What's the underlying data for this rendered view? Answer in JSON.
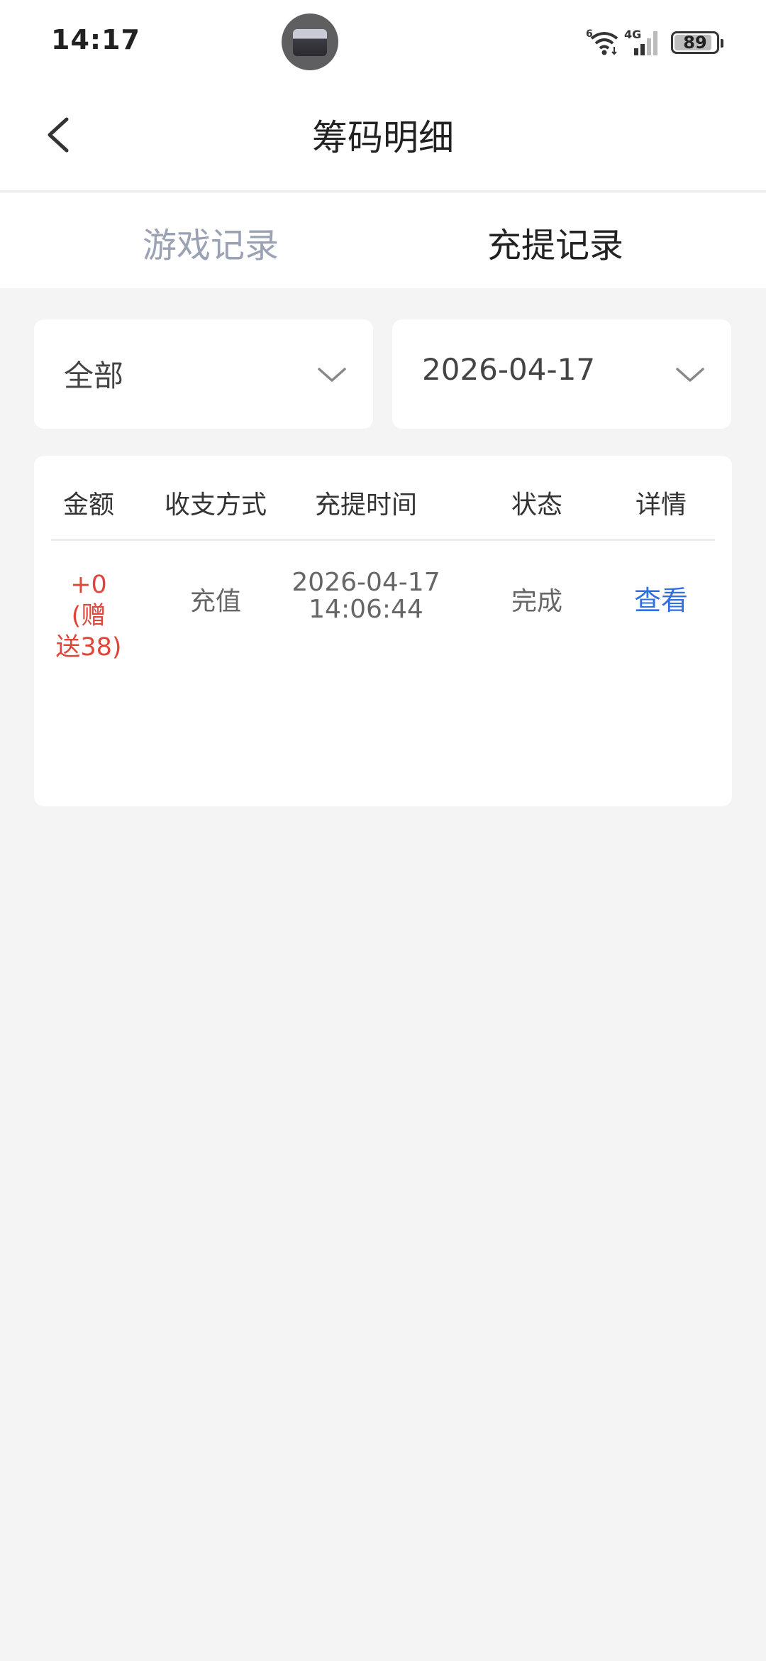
{
  "status_bar": {
    "time": "14:17",
    "battery": "89",
    "icons": [
      "wifi-icon",
      "signal-4g-icon",
      "battery-icon"
    ]
  },
  "nav": {
    "title": "筹码明细",
    "back_icon": "chevron-left-icon"
  },
  "tabs": [
    {
      "label": "游戏记录",
      "active": false
    },
    {
      "label": "充提记录",
      "active": true
    }
  ],
  "filters": {
    "type": {
      "value": "全部"
    },
    "date": {
      "value": "2026-04-17"
    }
  },
  "table": {
    "headers": [
      "金额",
      "收支方式",
      "充提时间",
      "状态",
      "详情"
    ],
    "rows": [
      {
        "amount_line1": "+0 (赠",
        "amount_line2": "送38)",
        "method": "充值",
        "date": "2026-04-17",
        "time": "14:06:44",
        "status": "完成",
        "detail_link": "查看"
      }
    ]
  },
  "colors": {
    "amount_red": "#e0453a",
    "link_blue": "#2f6fe0",
    "inactive_tab": "#9aa2b3",
    "background": "#f4f4f4"
  }
}
